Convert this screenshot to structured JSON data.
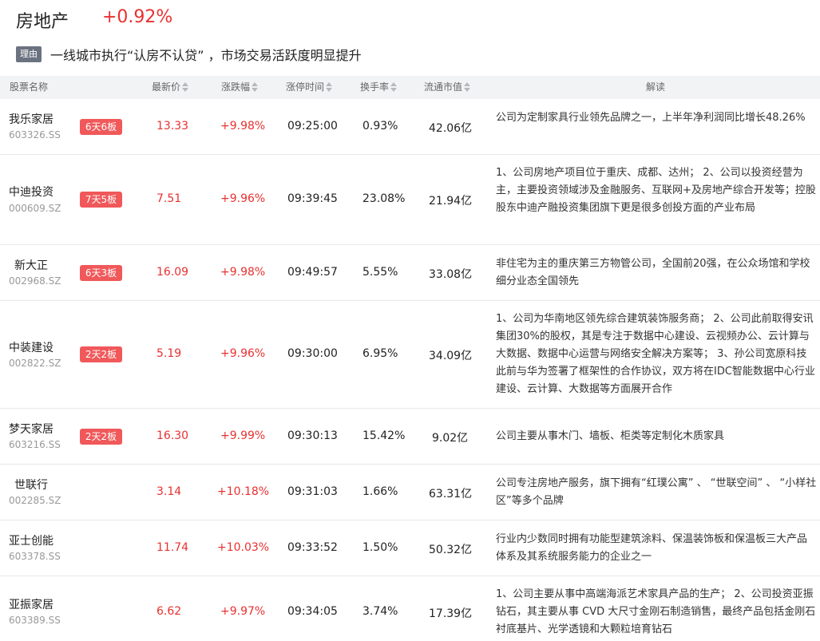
{
  "sector": {
    "name": "房地产",
    "change": "+0.92%",
    "reason_tag": "理由",
    "reason": "一线城市执行“认房不认贷” ，市场交易活跃度明显提升"
  },
  "columns": {
    "name": "股票名称",
    "price": "最新价",
    "change": "涨跌幅",
    "limit_time": "涨停时间",
    "turnover": "换手率",
    "float_cap": "流通市值",
    "interpretation": "解读"
  },
  "rows": [
    {
      "name": "我乐家居",
      "code": "603326.SS",
      "badge": "6天6板",
      "price": "13.33",
      "change": "+9.98%",
      "time": "09:25:00",
      "turnover": "0.93%",
      "cap": "42.06亿",
      "desc": "公司为定制家具行业领先品牌之一，上半年净利润同比增长48.26%"
    },
    {
      "name": "中迪投资",
      "code": "000609.SZ",
      "badge": "7天5板",
      "price": "7.51",
      "change": "+9.96%",
      "time": "09:39:45",
      "turnover": "23.08%",
      "cap": "21.94亿",
      "desc": "1、公司房地产项目位于重庆、成都、达州； 2、公司以投资经营为主，主要投资领域涉及金融服务、互联网+及房地产综合开发等；控股股东中迪产融投资集团旗下更是很多创投方面的产业布局"
    },
    {
      "name": "新大正",
      "code": "002968.SZ",
      "badge": "6天3板",
      "price": "16.09",
      "change": "+9.98%",
      "time": "09:49:57",
      "turnover": "5.55%",
      "cap": "33.08亿",
      "desc": "非住宅为主的重庆第三方物管公司，全国前20强，在公众场馆和学校细分业态全国领先"
    },
    {
      "name": "中装建设",
      "code": "002822.SZ",
      "badge": "2天2板",
      "price": "5.19",
      "change": "+9.96%",
      "time": "09:30:00",
      "turnover": "6.95%",
      "cap": "34.09亿",
      "desc": "1、公司为华南地区领先综合建筑装饰服务商； 2、公司此前取得安讯集团30%的股权，其是专注于数据中心建设、云视频办公、云计算与大数据、数据中心运营与网络安全解决方案等； 3、孙公司宽原科技此前与华为签署了框架性的合作协议，双方将在IDC智能数据中心行业建设、云计算、大数据等方面展开合作"
    },
    {
      "name": "梦天家居",
      "code": "603216.SS",
      "badge": "2天2板",
      "price": "16.30",
      "change": "+9.99%",
      "time": "09:30:13",
      "turnover": "15.42%",
      "cap": "9.02亿",
      "desc": "公司主要从事木门、墙板、柜类等定制化木质家具"
    },
    {
      "name": "世联行",
      "code": "002285.SZ",
      "badge": "",
      "price": "3.14",
      "change": "+10.18%",
      "time": "09:31:03",
      "turnover": "1.66%",
      "cap": "63.31亿",
      "desc": "公司专注房地产服务，旗下拥有“红璞公寓” 、 “世联空间” 、 “小样社区”等多个品牌"
    },
    {
      "name": "亚士创能",
      "code": "603378.SS",
      "badge": "",
      "price": "11.74",
      "change": "+10.03%",
      "time": "09:33:52",
      "turnover": "1.50%",
      "cap": "50.32亿",
      "desc": "行业内少数同时拥有功能型建筑涂料、保温装饰板和保温板三大产品体系及其系统服务能力的企业之一"
    },
    {
      "name": "亚振家居",
      "code": "603389.SS",
      "badge": "",
      "price": "6.62",
      "change": "+9.97%",
      "time": "09:34:05",
      "turnover": "3.74%",
      "cap": "17.39亿",
      "desc": "1、公司主要从事中高端海派艺术家具产品的生产； 2、公司投资亚振钻石，其主要从事 CVD 大尺寸金刚石制造销售，最终产品包括金刚石衬底基片、光学透镜和大颗粒培育钻石"
    }
  ]
}
